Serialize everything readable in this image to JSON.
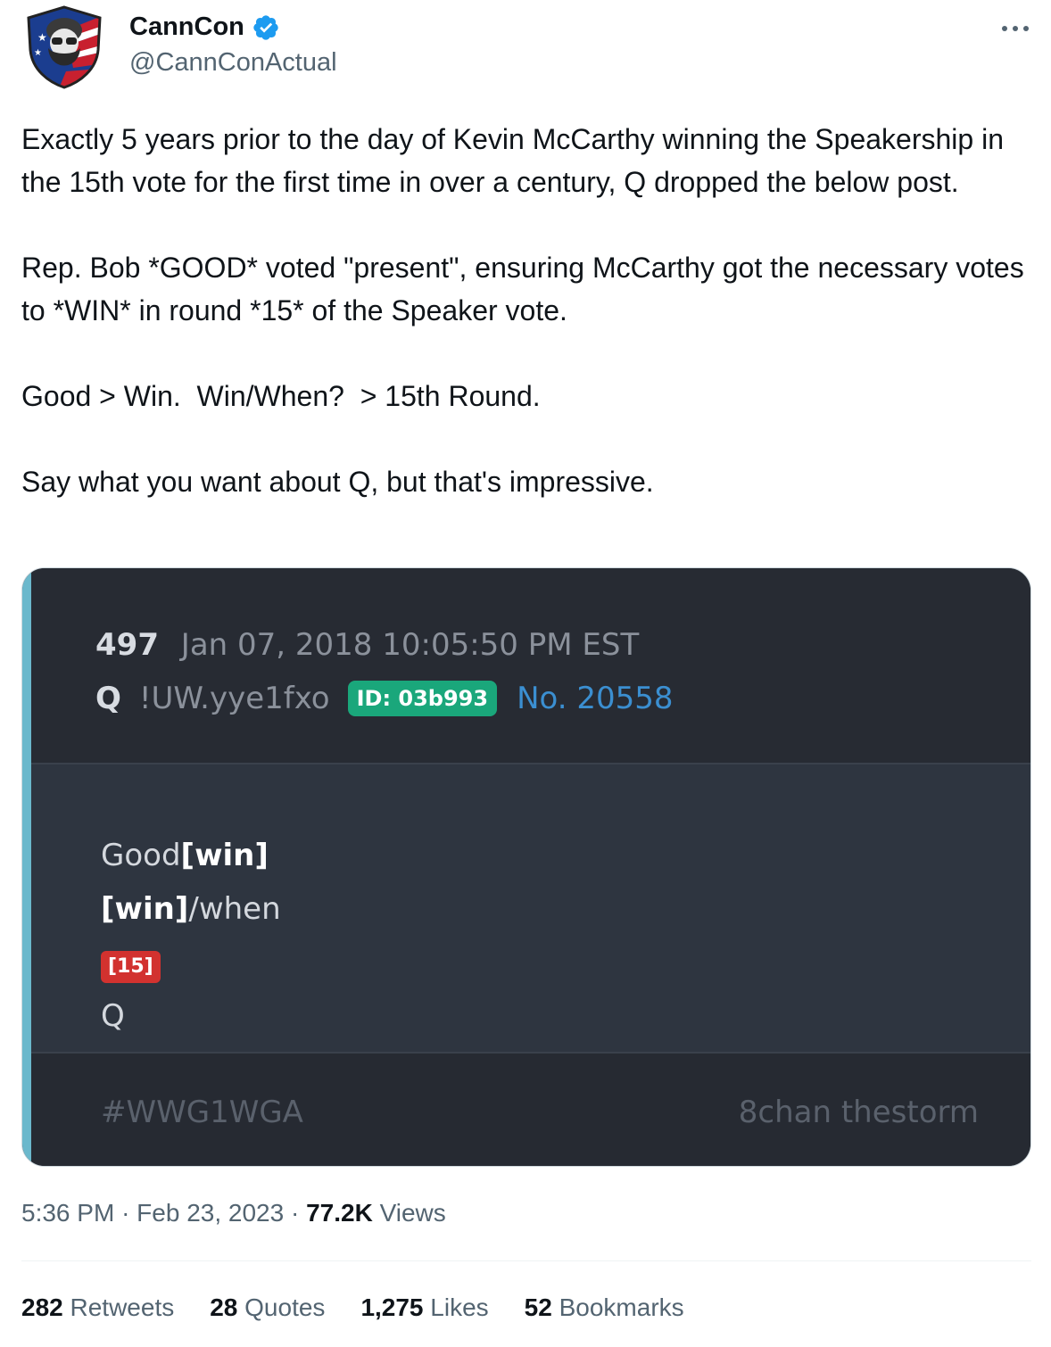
{
  "author": {
    "display_name": "CannCon",
    "handle": "@CannConActual",
    "verified_icon": "verified-badge-icon",
    "avatar_icon": "avatar-bearded-man-shield"
  },
  "tweet": {
    "paragraphs": [
      "Exactly 5 years prior to the day of Kevin McCarthy winning the Speakership in the 15th vote for the first time in over a century, Q dropped the below post.",
      "Rep. Bob *GOOD* voted \"present\", ensuring McCarthy got the necessary votes to *WIN* in round *15* of the Speaker vote.",
      "Good > Win.  Win/When?  > 15th Round.",
      "Say what you want about Q, but that's impressive."
    ]
  },
  "embedded_post": {
    "number": "497",
    "date": "Jan 07, 2018 10:05:50 PM EST",
    "name": "Q",
    "tripcode": "!UW.yye1fxo",
    "id_badge": "ID: 03b993",
    "post_no": "No. 20558",
    "body": {
      "line1_plain": "Good",
      "line1_bold": "[win]",
      "line2_bold": "[win]",
      "line2_plain": "/when",
      "line3_badge": "[15]",
      "line4": "Q"
    },
    "footer_left": "#WWG1WGA",
    "footer_right": "8chan thestorm",
    "colors": {
      "accent": "#6bb8cc",
      "id_badge": "#1aa77b",
      "post_no": "#3b8fd1",
      "red_badge": "#d2322f"
    }
  },
  "meta": {
    "time": "5:36 PM",
    "separator": "·",
    "date": "Feb 23, 2023",
    "views_count": "77.2K",
    "views_label": "Views"
  },
  "stats": [
    {
      "count": "282",
      "label": "Retweets"
    },
    {
      "count": "28",
      "label": "Quotes"
    },
    {
      "count": "1,275",
      "label": "Likes"
    },
    {
      "count": "52",
      "label": "Bookmarks"
    }
  ]
}
